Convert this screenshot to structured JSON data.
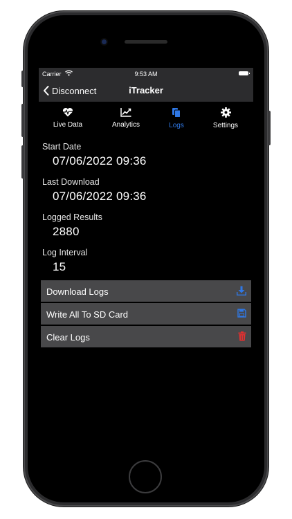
{
  "status_bar": {
    "carrier": "Carrier",
    "time": "9:53 AM"
  },
  "nav": {
    "back_label": "Disconnect",
    "title": "iTracker"
  },
  "tabs": [
    {
      "label": "Live Data",
      "icon": "heart-pulse-icon",
      "active": false
    },
    {
      "label": "Analytics",
      "icon": "line-chart-icon",
      "active": false
    },
    {
      "label": "Logs",
      "icon": "documents-icon",
      "active": true
    },
    {
      "label": "Settings",
      "icon": "gear-icon",
      "active": false
    }
  ],
  "fields": {
    "start_date": {
      "label": "Start Date",
      "value": "07/06/2022 09:36"
    },
    "last_download": {
      "label": "Last Download",
      "value": "07/06/2022 09:36"
    },
    "logged_results": {
      "label": "Logged Results",
      "value": "2880"
    },
    "log_interval": {
      "label": "Log Interval",
      "value": "15"
    }
  },
  "actions": [
    {
      "label": "Download Logs",
      "icon": "download-icon",
      "color": "#2f78e6"
    },
    {
      "label": "Write All To SD Card",
      "icon": "floppy-disk-icon",
      "color": "#2f78e6"
    },
    {
      "label": "Clear Logs",
      "icon": "trash-icon",
      "color": "#e03030"
    }
  ],
  "colors": {
    "accent": "#2f78e6",
    "danger": "#e03030",
    "bar_background": "#2c2c2e",
    "button_background": "#48484a"
  }
}
